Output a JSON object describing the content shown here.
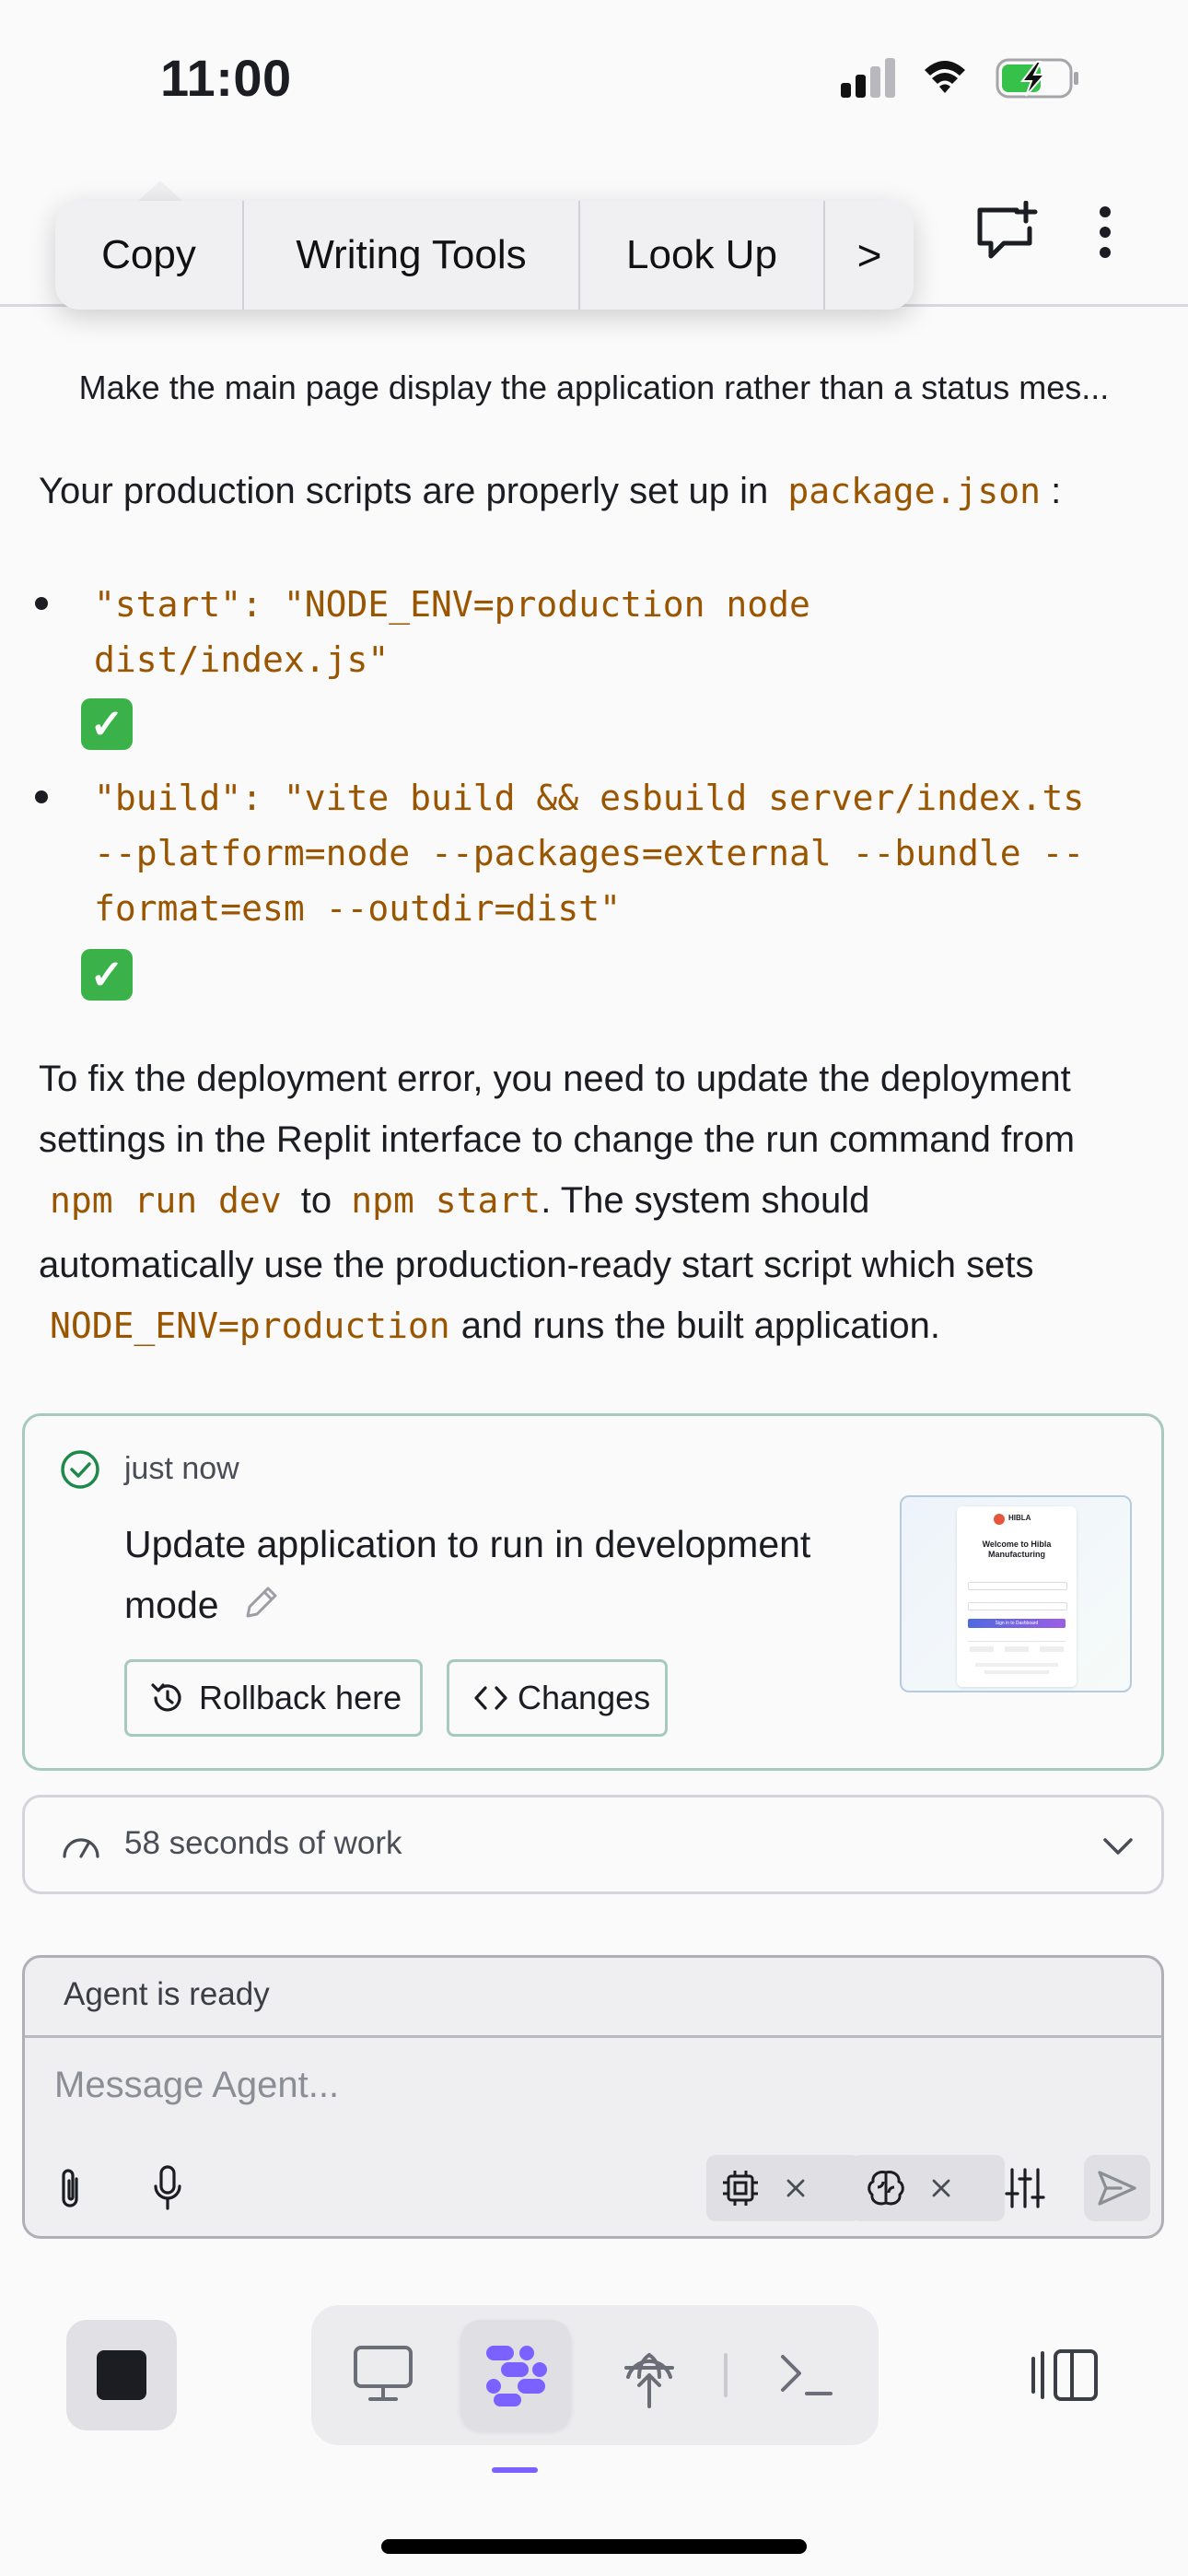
{
  "status_bar": {
    "time": "11:00"
  },
  "edit_menu": {
    "items": [
      "Copy",
      "Writing Tools",
      "Look Up"
    ],
    "more": ">"
  },
  "chat": {
    "user_message": "Make the main page display the application rather than a status mes...",
    "para1_prefix": "Your production scripts are properly set up in",
    "para1_code": "package.json",
    "para1_suffix": ":",
    "bullets": [
      {
        "code_line1": "\"start\": \"NODE_ENV=production node",
        "code_line2": "dist/index.js\"",
        "code_line3": ""
      },
      {
        "code_line1": "\"build\": \"vite build && esbuild server/index.ts",
        "code_line2": "--platform=node --packages=external --bundle --",
        "code_line3": "format=esm --outdir=dist\""
      }
    ],
    "para2": {
      "line1": "To fix the deployment error, you need to update the deployment",
      "line2": "settings in the Replit interface to change the run command from",
      "code_dev": "npm run dev",
      "word_to": "to",
      "code_start": "npm start",
      "line3_suffix": ". The system should",
      "line4": "automatically use the production-ready start script which sets",
      "code_env": "NODE_ENV=production",
      "line5_suffix": "and runs the built application."
    }
  },
  "checkpoint": {
    "time": "just now",
    "title_line1": "Update application to run in development",
    "title_line2": "mode",
    "rollback_label": "Rollback here",
    "changes_label": "Changes",
    "thumbnail": {
      "brand": "HIBLA",
      "heading_line1": "Welcome to Hibla",
      "heading_line2": "Manufacturing",
      "button": "Sign in to Dashboard"
    }
  },
  "work": {
    "label": "58 seconds of work"
  },
  "composer": {
    "status": "Agent is ready",
    "placeholder": "Message Agent..."
  },
  "colors": {
    "accent": "#7b61ff",
    "code": "#9a5500",
    "success": "#3bb14a",
    "card_border": "#a8c9bd"
  }
}
